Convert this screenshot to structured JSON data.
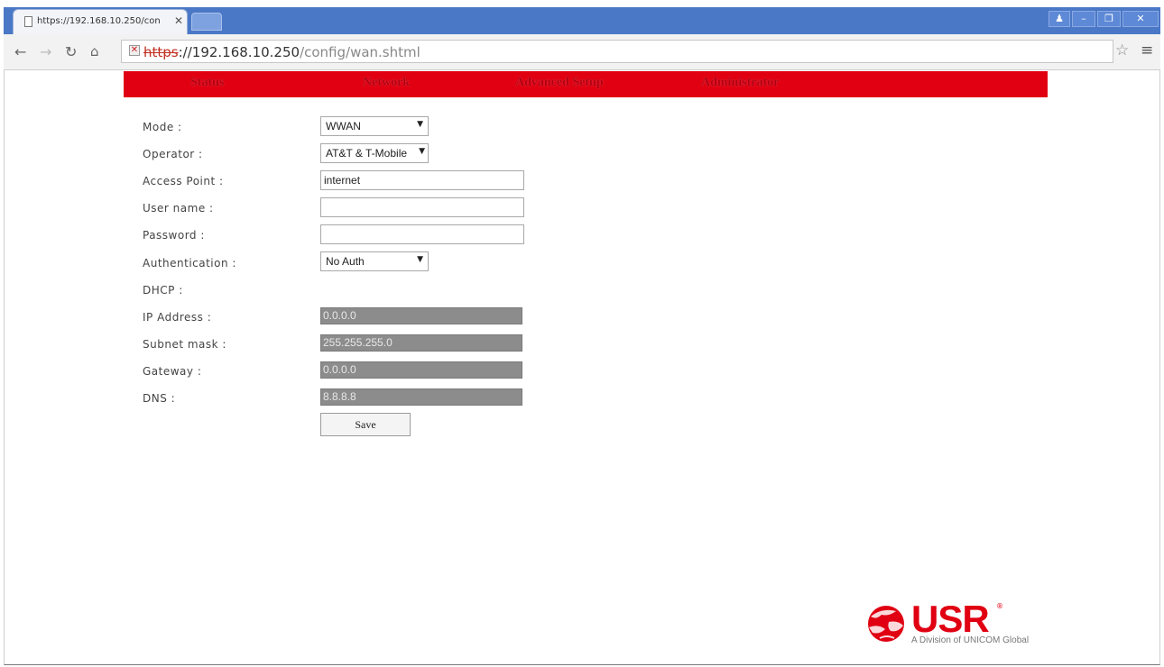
{
  "browser": {
    "tab_title": "https://192.168.10.250/con",
    "url_scheme": "https",
    "url_host": "://192.168.10.250",
    "url_path": "/config/wan.shtml",
    "window_controls": [
      "person-icon",
      "minimize-icon",
      "restore-icon",
      "close-icon"
    ]
  },
  "nav": {
    "items": [
      "Status",
      "Network",
      "Advanced Setup",
      "Administrator"
    ],
    "color": "#e00012"
  },
  "form": {
    "mode_label": "Mode :",
    "mode_value": "WWAN",
    "operator_label": "Operator :",
    "operator_value": "AT&T & T-Mobile",
    "apn_label": "Access Point :",
    "apn_value": "internet",
    "username_label": "User name :",
    "username_value": "",
    "password_label": "Password :",
    "password_value": "",
    "auth_label": "Authentication :",
    "auth_value": "No Auth",
    "dhcp_label": "DHCP :",
    "ip_label": "IP Address :",
    "ip_value": "0.0.0.0",
    "subnet_label": "Subnet mask :",
    "subnet_value": "255.255.255.0",
    "gateway_label": "Gateway :",
    "gateway_value": "0.0.0.0",
    "dns_label": "DNS :",
    "dns_value": "8.8.8.8",
    "save_label": "Save"
  },
  "logo": {
    "text": "USR",
    "reg": "®",
    "tagline": "A Division of UNICOM Global"
  }
}
